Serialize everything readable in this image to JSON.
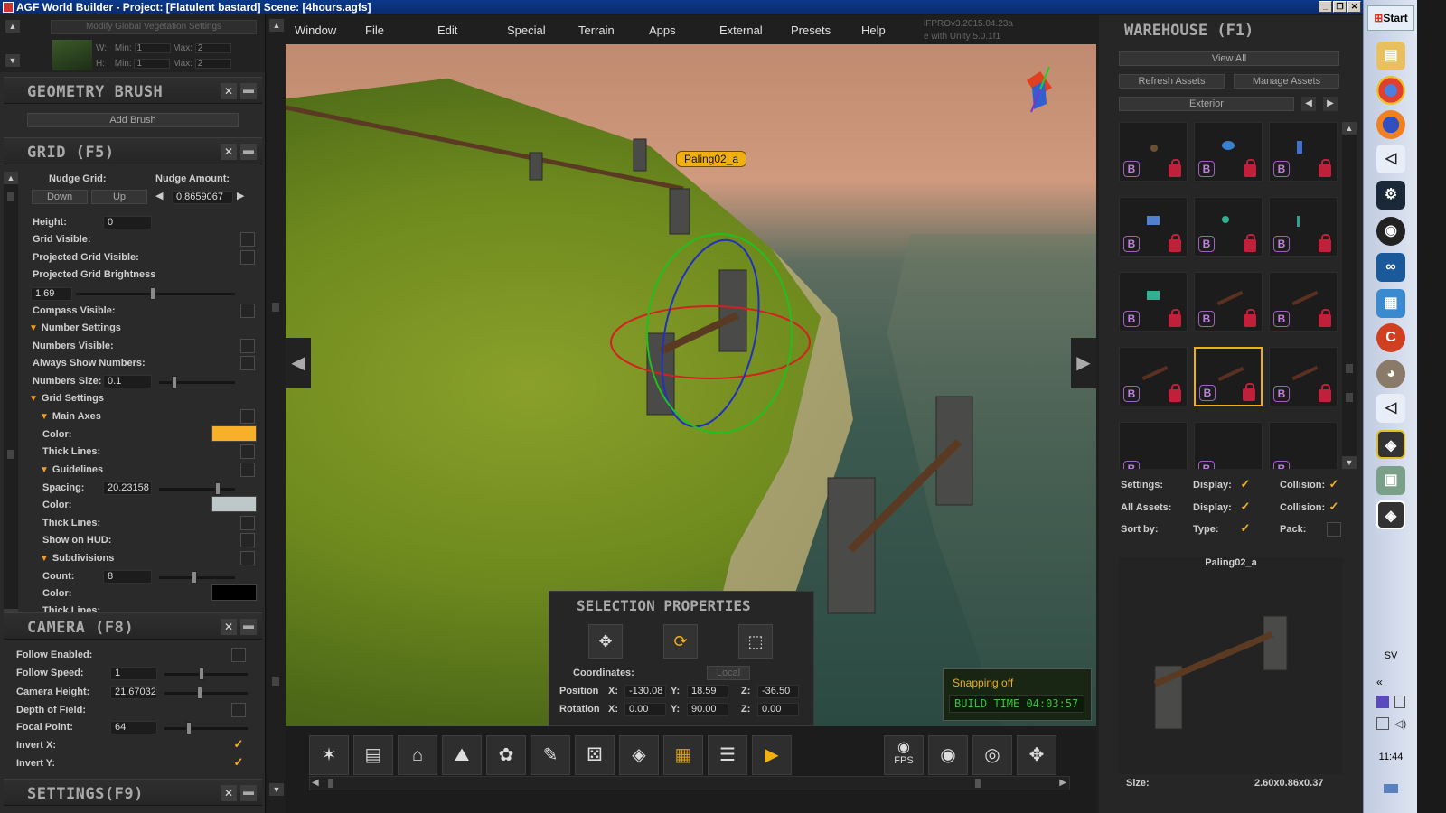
{
  "window": {
    "title": "AGF World Builder - Project: [Flatulent bastard] Scene: [4hours.agfs]",
    "controls": [
      "_",
      "❐",
      "✕"
    ]
  },
  "vegetation": {
    "button": "Modify Global Vegetation Settings",
    "w_label": "W:",
    "h_label": "H:",
    "min_label": "Min:",
    "max_label": "Max:",
    "w_min": "1",
    "w_max": "2",
    "h_min": "1",
    "h_max": "2"
  },
  "geometry_brush": {
    "title": "GEOMETRY BRUSH",
    "add_brush": "Add Brush"
  },
  "grid": {
    "title": "GRID (F5)",
    "nudge_grid_label": "Nudge Grid:",
    "nudge_amount_label": "Nudge Amount:",
    "down": "Down",
    "up": "Up",
    "nudge_amount": "0.8659067",
    "height_label": "Height:",
    "height": "0",
    "grid_visible": "Grid Visible:",
    "projected_grid_visible": "Projected Grid Visible:",
    "projected_grid_brightness": "Projected Grid Brightness",
    "brightness_value": "1.69",
    "compass_visible": "Compass Visible:",
    "number_settings": "Number Settings",
    "numbers_visible": "Numbers Visible:",
    "always_show_numbers": "Always Show Numbers:",
    "numbers_size_label": "Numbers Size:",
    "numbers_size": "0.1",
    "grid_settings": "Grid Settings",
    "main_axes": "Main Axes",
    "color_label": "Color:",
    "main_axes_color": "#f7b027",
    "thick_lines": "Thick Lines:",
    "guidelines": "Guidelines",
    "spacing_label": "Spacing:",
    "spacing": "20.23158",
    "guidelines_color": "#bfc8c8",
    "show_on_hud": "Show on HUD:",
    "subdivisions": "Subdivisions",
    "count_label": "Count:",
    "count": "8",
    "subdivisions_color": "#000000",
    "thick_lines_cut": "Thick Lines:"
  },
  "camera": {
    "title": "CAMERA (F8)",
    "follow_enabled": "Follow Enabled:",
    "follow_speed_label": "Follow Speed:",
    "follow_speed": "1",
    "camera_height_label": "Camera Height:",
    "camera_height": "21.67032",
    "depth_of_field": "Depth of Field:",
    "focal_point_label": "Focal Point:",
    "focal_point": "64",
    "invert_x": "Invert X:",
    "invert_y": "Invert Y:",
    "check": "✓"
  },
  "settings": {
    "title": "SETTINGS(F9)"
  },
  "menu": [
    "Window",
    "File",
    "Edit",
    "Special",
    "Terrain",
    "Apps",
    "External",
    "Presets",
    "Help"
  ],
  "version": {
    "line1": "iFPROv3.2015.04.23a",
    "line2": "e with Unity 5.0.1f1"
  },
  "viewport": {
    "selected_label": "Paling02_a"
  },
  "selection_properties": {
    "title": "SELECTION PROPERTIES",
    "coordinates": "Coordinates:",
    "local": "Local",
    "position_label": "Position",
    "rotation_label": "Rotation",
    "x_label": "X:",
    "y_label": "Y:",
    "z_label": "Z:",
    "pos_x": "-130.08",
    "pos_y": "18.59",
    "pos_z": "-36.50",
    "rot_x": "0.00",
    "rot_y": "90.00",
    "rot_z": "0.00"
  },
  "snap": {
    "status": "Snapping off",
    "build_time": "BUILD TIME 04:03:57"
  },
  "toolbar": {
    "fps": "FPS"
  },
  "warehouse": {
    "title": "WAREHOUSE (F1)",
    "view_all": "View All",
    "refresh_assets": "Refresh Assets",
    "manage_assets": "Manage Assets",
    "category": "Exterior",
    "b_glyph": "B",
    "settings_label": "Settings:",
    "all_assets_label": "All Assets:",
    "sort_by_label": "Sort by:",
    "display_label": "Display:",
    "collision_label": "Collision:",
    "type_label": "Type:",
    "pack_label": "Pack:",
    "check": "✓",
    "preview_name": "Paling02_a",
    "size_label": "Size:",
    "size_value": "2.60x0.86x0.37"
  },
  "taskbar": {
    "start": "Start",
    "lang": "SV",
    "clock": "11:44",
    "collapse": "«"
  }
}
